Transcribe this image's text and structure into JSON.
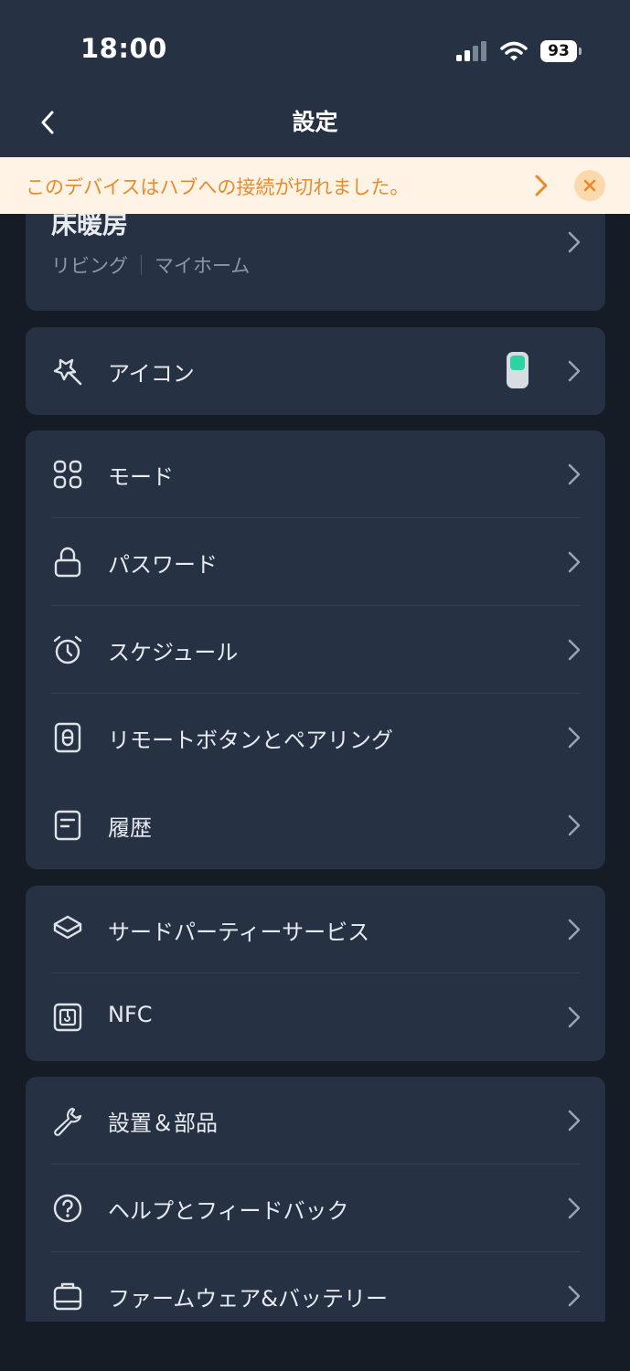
{
  "status_bar": {
    "time": "18:00",
    "battery": "93"
  },
  "header": {
    "title": "設定"
  },
  "banner": {
    "text": "このデバイスはハブへの接続が切れました。"
  },
  "device": {
    "name": "床暖房",
    "room": "リビング",
    "home": "マイホーム"
  },
  "icon_row": {
    "label": "アイコン"
  },
  "group1": {
    "items": [
      {
        "label": "モード"
      },
      {
        "label": "パスワード"
      },
      {
        "label": "スケジュール"
      },
      {
        "label": "リモートボタンとペアリング"
      },
      {
        "label": "履歴"
      }
    ]
  },
  "group2": {
    "items": [
      {
        "label": "サードパーティーサービス"
      },
      {
        "label": "NFC"
      }
    ]
  },
  "group3": {
    "items": [
      {
        "label": "設置＆部品"
      },
      {
        "label": "ヘルプとフィードバック"
      },
      {
        "label": "ファームウェア&バッテリー"
      }
    ]
  },
  "colors": {
    "background": "#151c26",
    "card": "#263244",
    "banner_bg": "#fff3e6",
    "banner_text": "#e98a2b",
    "accent_green": "#2ed3a3"
  }
}
